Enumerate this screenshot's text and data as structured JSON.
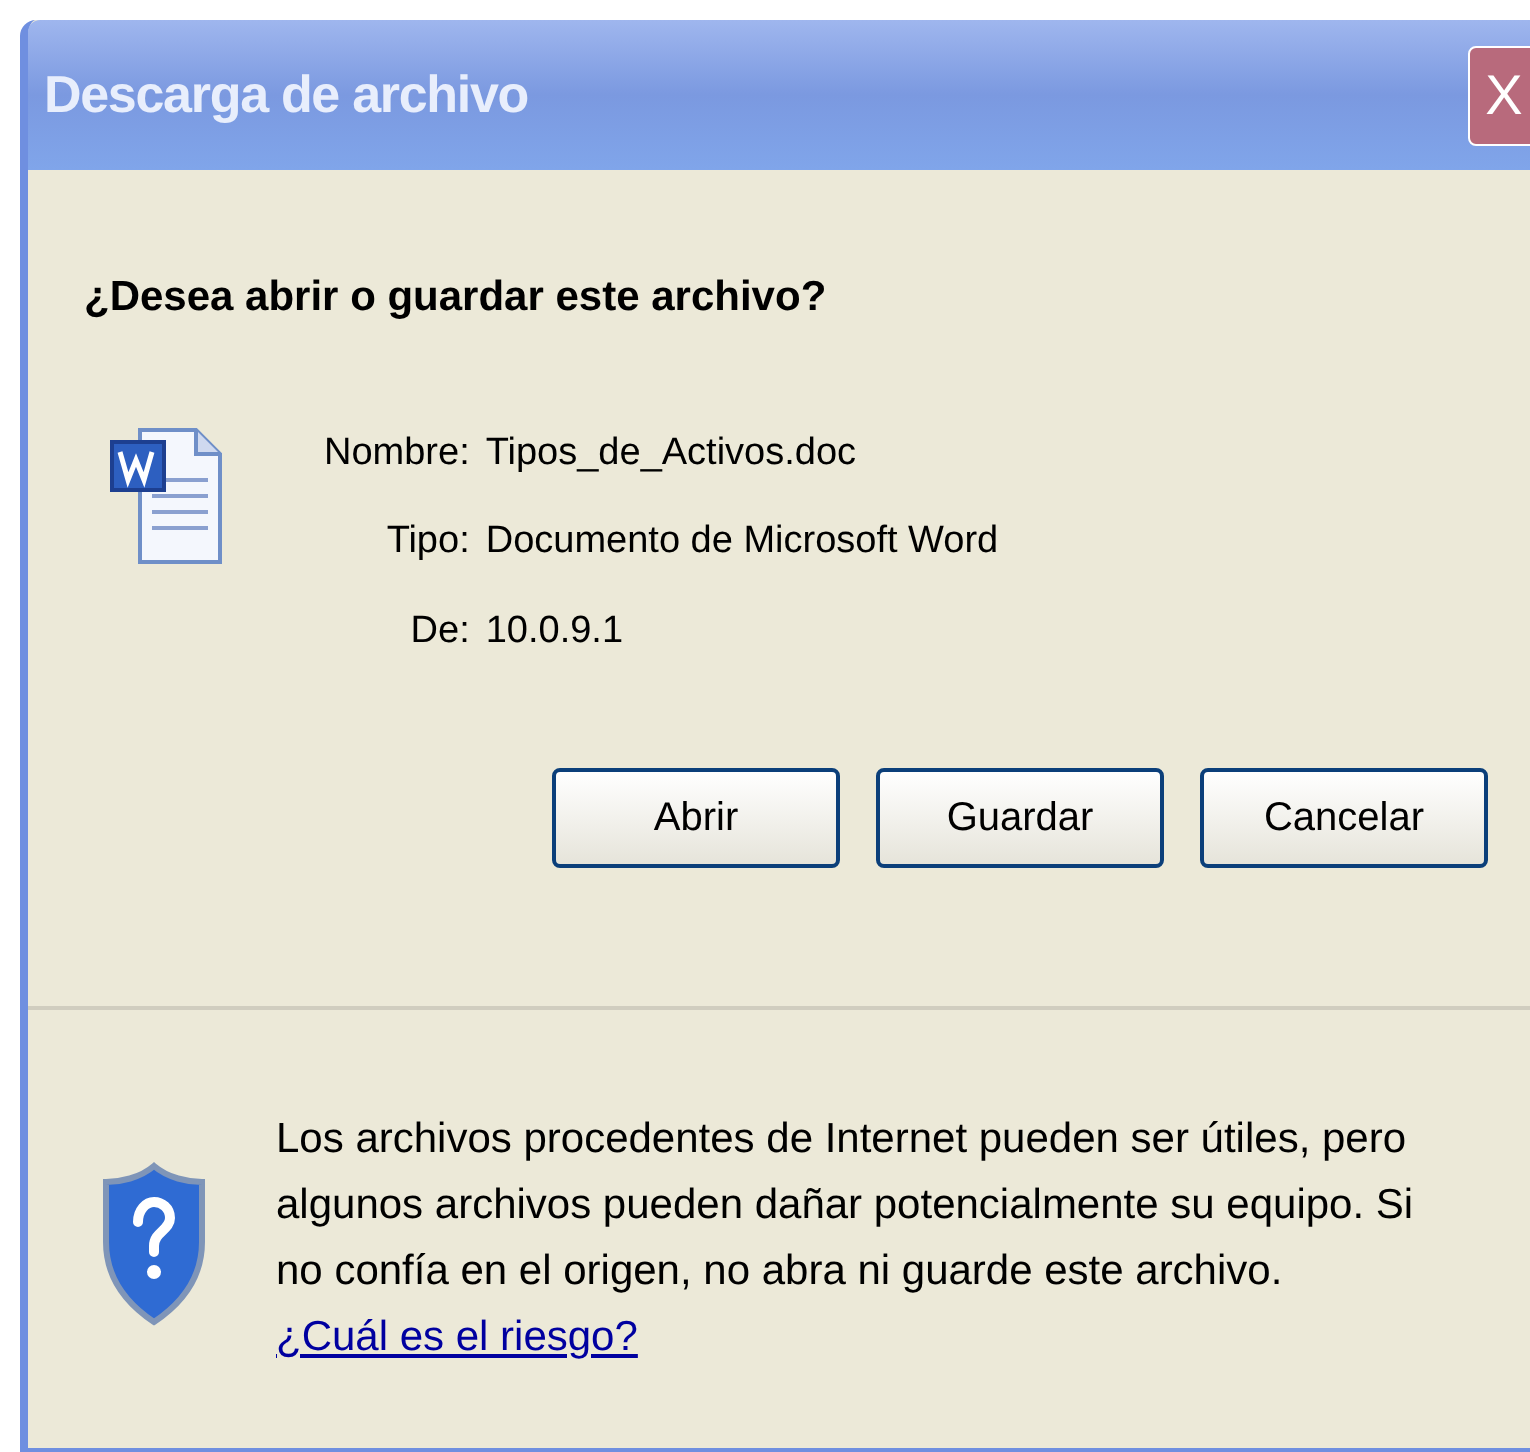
{
  "window": {
    "title": "Descarga de archivo",
    "close": "X"
  },
  "question": "¿Desea abrir o guardar este archivo?",
  "file_info": [
    {
      "label": "Nombre:",
      "value": "Tipos_de_Activos.doc"
    },
    {
      "label": "Tipo:",
      "value": "Documento de Microsoft Word"
    },
    {
      "label": "De:",
      "value": "10.0.9.1"
    }
  ],
  "buttons": [
    "Abrir",
    "Guardar",
    "Cancelar"
  ],
  "warning": {
    "text": "Los archivos procedentes de Internet pueden ser útiles, pero algunos archivos pueden dañar potencialmente su equipo. Si no confía en el origen, no abra ni guarde este archivo.",
    "link": "¿Cuál es el riesgo?"
  }
}
